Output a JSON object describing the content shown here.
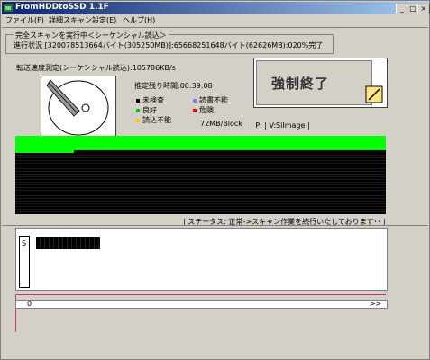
{
  "window": {
    "title": "FromHDDtoSSD  1.1F",
    "controls": {
      "minimize": "_",
      "maximize": "□",
      "close": "×"
    }
  },
  "menu": [
    {
      "label": "ファイル(F)"
    },
    {
      "label": "詳細スキャン設定(E)"
    },
    {
      "label": "ヘルプ(H)"
    }
  ],
  "scan": {
    "group_title": "完全スキャンを実行中＜シーケンシャル読込＞",
    "progress_text": "進行状況 [320078513664バイト(305250MB)]:65668251648バイト(62626MB):020%完了",
    "speed_text": "転送速度測定(シーケンシャル読込):105786KB/s",
    "remaining_text": "推定残り時間:00:39:08"
  },
  "stop_button": {
    "label": "強制終了"
  },
  "legend": [
    {
      "label": "未検査",
      "color": "#000000"
    },
    {
      "label": "読書不能",
      "color": "#8080ff"
    },
    {
      "label": "良好",
      "color": "#00cc00"
    },
    {
      "label": "危険",
      "color": "#ff0000"
    },
    {
      "label": "読込不能",
      "color": "#ffcc00"
    }
  ],
  "block_info": "72MB/Block",
  "drive_info": "| P:  | V:SiImage |",
  "status_line": "| ステータス: 正常->スキャン作業を続行いたしております･･ |",
  "log_panel": {
    "s_label": "S"
  },
  "footer": {
    "start_value": "0",
    "next_label": ">>"
  },
  "colors": {
    "good": "#00ff00",
    "unchecked": "#000000",
    "accent_line": "#cc3366"
  }
}
